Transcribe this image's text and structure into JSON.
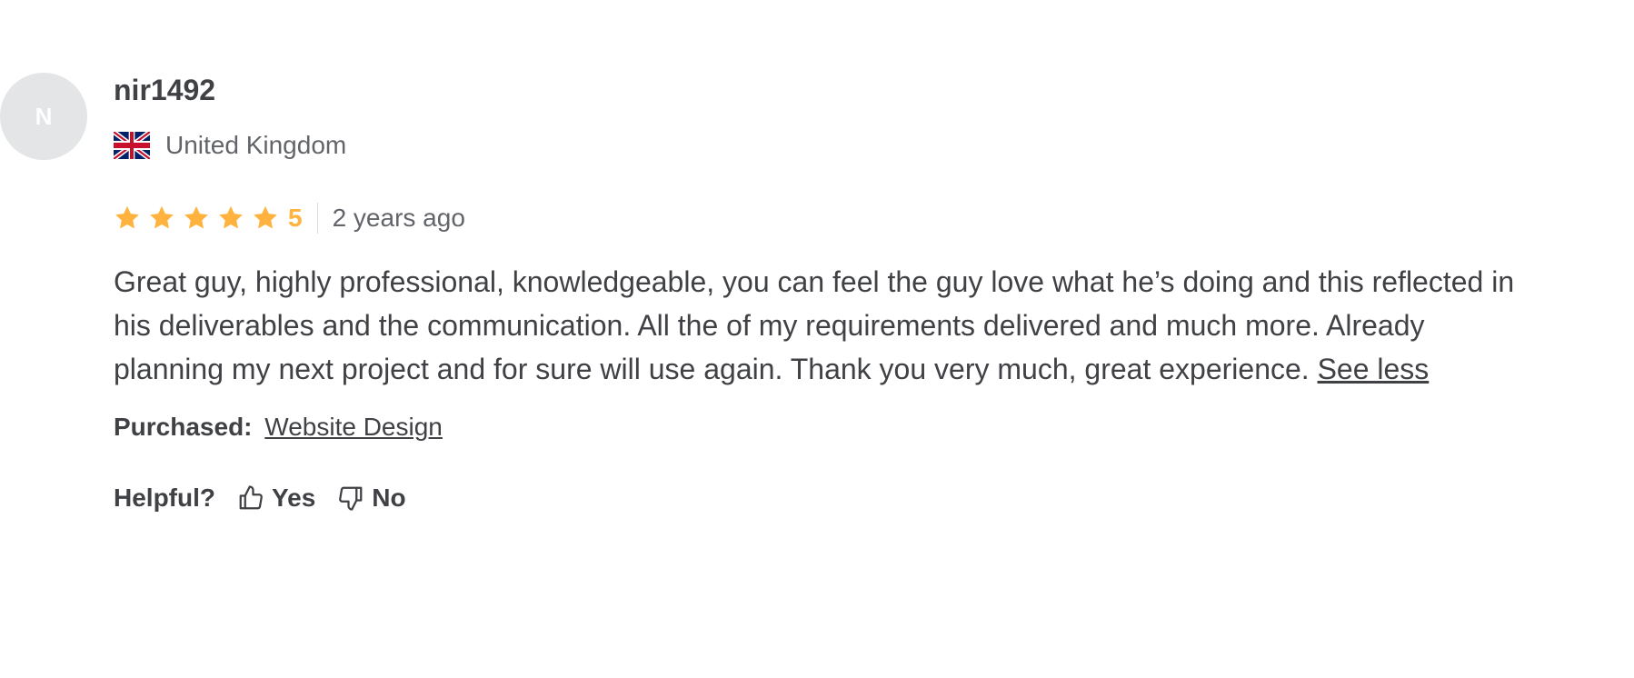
{
  "review": {
    "avatar_initial": "N",
    "username": "nir1492",
    "country": {
      "flag_icon": "uk-flag-icon",
      "name": "United Kingdom"
    },
    "rating": {
      "stars": 5,
      "max_stars": 5,
      "value": "5",
      "star_color": "#ffb33e"
    },
    "time_ago": "2 years ago",
    "text": "Great guy, highly professional, knowledgeable, you can feel the guy love what he’s doing and this reflected in his deliverables and the communication. All the of my requirements delivered and much more. Already planning my next project and for sure will use again. Thank you very much, great experience.",
    "see_less_label": "See less",
    "purchased": {
      "label": "Purchased:",
      "item": "Website Design"
    },
    "helpful": {
      "label": "Helpful?",
      "yes_label": "Yes",
      "yes_icon": "thumbs-up-icon",
      "no_label": "No",
      "no_icon": "thumbs-down-icon"
    }
  }
}
